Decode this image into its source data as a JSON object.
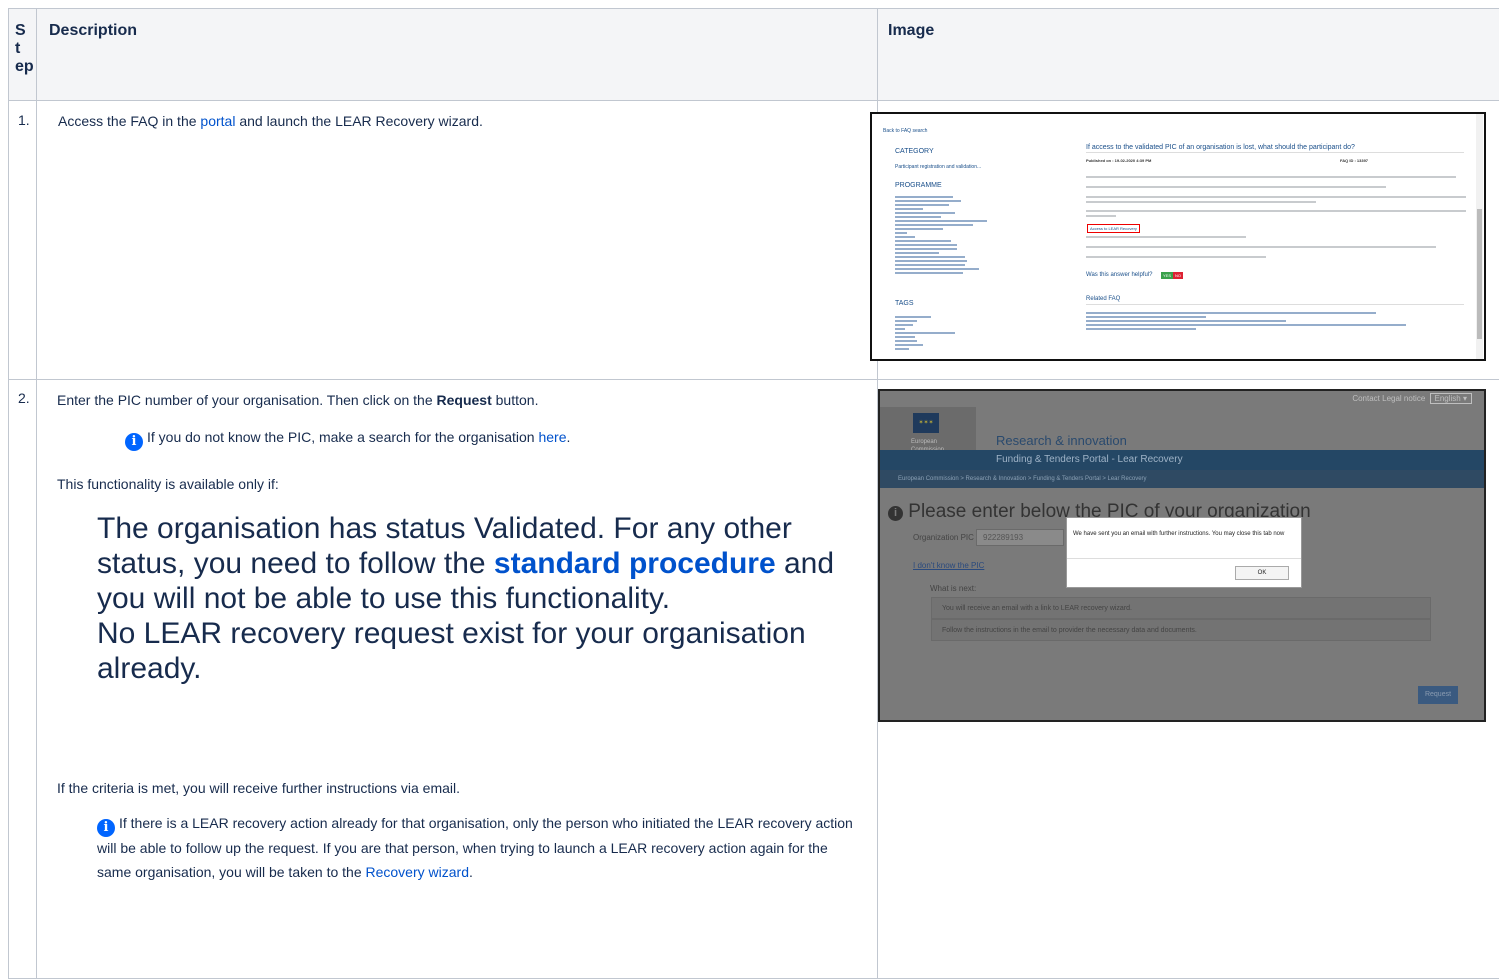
{
  "table": {
    "headers": {
      "step": "S\nt\nep",
      "description": "Description",
      "image": "Image"
    }
  },
  "rows": [
    {
      "step": "1.",
      "text_before": "Access the FAQ in the ",
      "link": "portal",
      "text_after": " and launch the LEAR Recovery wizard."
    },
    {
      "step": "2.",
      "intro_before": "Enter the PIC number of your organisation. Then click on the ",
      "intro_bold": "Request",
      "intro_after": " button.",
      "info1_before": "If you do not know the PIC, make a search for the organisation ",
      "info1_link": "here",
      "info1_after": ".",
      "avail": "This functionality is available only if:",
      "big1_before": "The organisation has status Validated. For any other status, you need to follow the ",
      "big1_link": "standard procedure",
      "big1_after": " and you will not be able to use this functionality.",
      "big2": "No LEAR recovery request exist for your organisation already.",
      "criteria": "If the criteria is met, you will receive further instructions via email.",
      "info2": "If there is a LEAR recovery action already for that organisation, only the person who initiated the LEAR recovery action will be able to follow up the request. If you are that person, when trying to launch a LEAR recovery action again for the same organisation, you will be taken to the ",
      "info2_link": "Recovery wizard",
      "info2_after": "."
    }
  ],
  "screenshot1": {
    "back": "Back to FAQ search",
    "category_h": "CATEGORY",
    "category_v": "Participant registration and validation...",
    "programme_h": "PROGRAMME",
    "tags_h": "TAGS",
    "question": "If access to the validated PIC of an organisation is lost, what should the participant do?",
    "published": "Published on : 19-02-2020 4:39 PM",
    "faq_id": "FAQ ID : 13397",
    "access_link": "Access to LEAR Recovery",
    "helpful": "Was this answer helpful?",
    "yes": "YES",
    "no": "NO",
    "related": "Related FAQ"
  },
  "screenshot2": {
    "top_links": "Contact  Legal notice",
    "lang": "English",
    "brand_line1": "European",
    "brand_line2": "Commission",
    "site_title": "Research & innovation",
    "portal_title": "Funding & Tenders Portal - Lear Recovery",
    "breadcrumb": "European Commission > Research & Innovation > Funding & Tenders Portal > Lear Recovery",
    "heading": "Please enter below the PIC of your organization",
    "org_label": "Organization PIC",
    "org_value": "922289193",
    "dont_know": "I don't know the PIC",
    "whats_next": "What is next:",
    "step_a": "You will receive an email with a link to LEAR recovery wizard.",
    "step_b": "Follow the instructions in the email to provider the necessary data and documents.",
    "modal_text": "We have sent you an email with further instructions. You may close this tab now",
    "ok": "OK",
    "request": "Request"
  },
  "colors": {
    "link": "#0052cc",
    "header_bg": "#f4f5f7",
    "border": "#c1c7d0",
    "ec_blue": "#0d4a8a",
    "info": "#0065ff"
  }
}
